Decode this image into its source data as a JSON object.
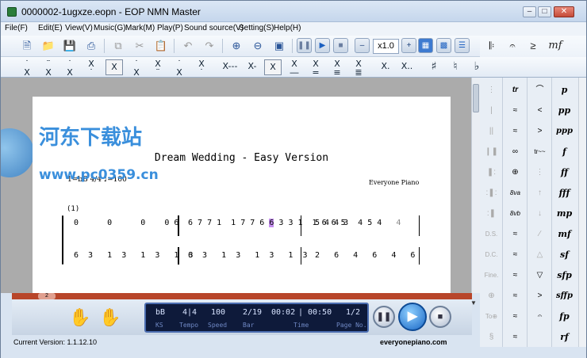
{
  "window": {
    "title": "0000002-1ugxze.eopn - EOP NMN Master"
  },
  "menu": [
    {
      "label": "File(F)"
    },
    {
      "label": "Edit(E)"
    },
    {
      "label": "View(V)"
    },
    {
      "label": "Music(G)"
    },
    {
      "label": "Mark(M)"
    },
    {
      "label": "Play(P)"
    },
    {
      "label": "Sound source(V)"
    },
    {
      "label": "Setting(S)"
    },
    {
      "label": "Help(H)"
    }
  ],
  "toolbar": {
    "speed": "x1.0"
  },
  "score": {
    "title": "Dream Wedding - Easy Version",
    "key_tempo": "1=bB 4/4  ♩=100",
    "composer": "Everyone Piano",
    "measure_number": "(1)"
  },
  "watermark": {
    "cn": "河东下载站",
    "url": "www.pc0359.cn"
  },
  "ruler": {
    "mark": "2"
  },
  "lcd": {
    "values": [
      "bB",
      "4|4",
      "100",
      "2/19",
      "00:02",
      "|",
      "00:50",
      "1/2"
    ],
    "labels": [
      "KS",
      "Tempo",
      "Speed",
      "Bar",
      "Time",
      "Page No."
    ]
  },
  "status": {
    "version": "Current Version: 1.1.12.10",
    "site": "everyonepiano.com"
  },
  "dynamics_top": {
    "mf": "mf"
  },
  "dynamics": [
    "p",
    "pp",
    "ppp",
    "f",
    "ff",
    "fff",
    "mp",
    "mf",
    "sf",
    "sfp",
    "sffp",
    "fp",
    "rf"
  ],
  "ornaments": [
    "tr",
    "≈",
    "≈",
    "∞",
    "⊕",
    "8va",
    "8vb",
    "≈",
    "≈",
    "≈",
    "≈",
    "≈",
    "≈"
  ],
  "ds_labels": [
    "D.S.",
    "D.C.",
    "Fine.",
    "To⊕"
  ],
  "colors": {
    "accent": "#2a5598",
    "ruler": "#b8462a",
    "lcd_bg": "#0e1a3a"
  }
}
